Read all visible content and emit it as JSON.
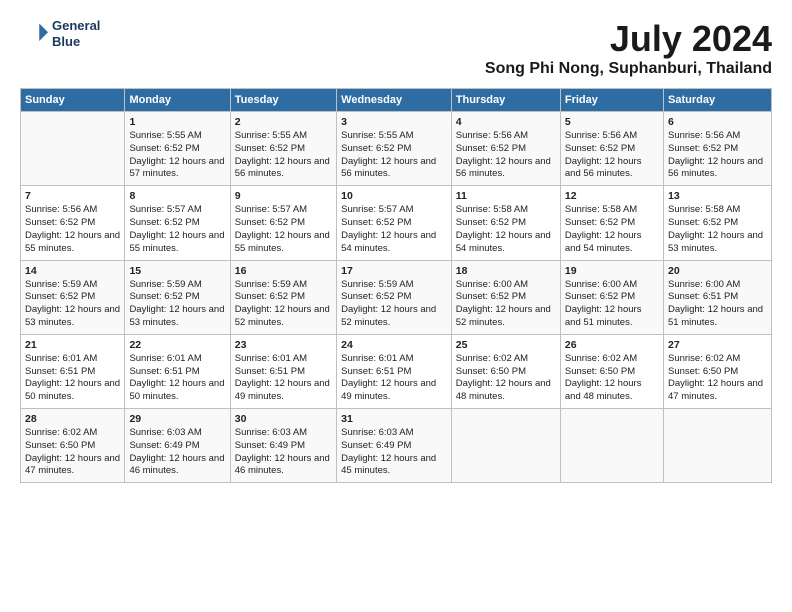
{
  "header": {
    "logo_line1": "General",
    "logo_line2": "Blue",
    "title": "July 2024",
    "subtitle": "Song Phi Nong, Suphanburi, Thailand"
  },
  "columns": [
    "Sunday",
    "Monday",
    "Tuesday",
    "Wednesday",
    "Thursday",
    "Friday",
    "Saturday"
  ],
  "weeks": [
    [
      {
        "day": "",
        "sunrise": "",
        "sunset": "",
        "daylight": ""
      },
      {
        "day": "1",
        "sunrise": "Sunrise: 5:55 AM",
        "sunset": "Sunset: 6:52 PM",
        "daylight": "Daylight: 12 hours and 57 minutes."
      },
      {
        "day": "2",
        "sunrise": "Sunrise: 5:55 AM",
        "sunset": "Sunset: 6:52 PM",
        "daylight": "Daylight: 12 hours and 56 minutes."
      },
      {
        "day": "3",
        "sunrise": "Sunrise: 5:55 AM",
        "sunset": "Sunset: 6:52 PM",
        "daylight": "Daylight: 12 hours and 56 minutes."
      },
      {
        "day": "4",
        "sunrise": "Sunrise: 5:56 AM",
        "sunset": "Sunset: 6:52 PM",
        "daylight": "Daylight: 12 hours and 56 minutes."
      },
      {
        "day": "5",
        "sunrise": "Sunrise: 5:56 AM",
        "sunset": "Sunset: 6:52 PM",
        "daylight": "Daylight: 12 hours and 56 minutes."
      },
      {
        "day": "6",
        "sunrise": "Sunrise: 5:56 AM",
        "sunset": "Sunset: 6:52 PM",
        "daylight": "Daylight: 12 hours and 56 minutes."
      }
    ],
    [
      {
        "day": "7",
        "sunrise": "Sunrise: 5:56 AM",
        "sunset": "Sunset: 6:52 PM",
        "daylight": "Daylight: 12 hours and 55 minutes."
      },
      {
        "day": "8",
        "sunrise": "Sunrise: 5:57 AM",
        "sunset": "Sunset: 6:52 PM",
        "daylight": "Daylight: 12 hours and 55 minutes."
      },
      {
        "day": "9",
        "sunrise": "Sunrise: 5:57 AM",
        "sunset": "Sunset: 6:52 PM",
        "daylight": "Daylight: 12 hours and 55 minutes."
      },
      {
        "day": "10",
        "sunrise": "Sunrise: 5:57 AM",
        "sunset": "Sunset: 6:52 PM",
        "daylight": "Daylight: 12 hours and 54 minutes."
      },
      {
        "day": "11",
        "sunrise": "Sunrise: 5:58 AM",
        "sunset": "Sunset: 6:52 PM",
        "daylight": "Daylight: 12 hours and 54 minutes."
      },
      {
        "day": "12",
        "sunrise": "Sunrise: 5:58 AM",
        "sunset": "Sunset: 6:52 PM",
        "daylight": "Daylight: 12 hours and 54 minutes."
      },
      {
        "day": "13",
        "sunrise": "Sunrise: 5:58 AM",
        "sunset": "Sunset: 6:52 PM",
        "daylight": "Daylight: 12 hours and 53 minutes."
      }
    ],
    [
      {
        "day": "14",
        "sunrise": "Sunrise: 5:59 AM",
        "sunset": "Sunset: 6:52 PM",
        "daylight": "Daylight: 12 hours and 53 minutes."
      },
      {
        "day": "15",
        "sunrise": "Sunrise: 5:59 AM",
        "sunset": "Sunset: 6:52 PM",
        "daylight": "Daylight: 12 hours and 53 minutes."
      },
      {
        "day": "16",
        "sunrise": "Sunrise: 5:59 AM",
        "sunset": "Sunset: 6:52 PM",
        "daylight": "Daylight: 12 hours and 52 minutes."
      },
      {
        "day": "17",
        "sunrise": "Sunrise: 5:59 AM",
        "sunset": "Sunset: 6:52 PM",
        "daylight": "Daylight: 12 hours and 52 minutes."
      },
      {
        "day": "18",
        "sunrise": "Sunrise: 6:00 AM",
        "sunset": "Sunset: 6:52 PM",
        "daylight": "Daylight: 12 hours and 52 minutes."
      },
      {
        "day": "19",
        "sunrise": "Sunrise: 6:00 AM",
        "sunset": "Sunset: 6:52 PM",
        "daylight": "Daylight: 12 hours and 51 minutes."
      },
      {
        "day": "20",
        "sunrise": "Sunrise: 6:00 AM",
        "sunset": "Sunset: 6:51 PM",
        "daylight": "Daylight: 12 hours and 51 minutes."
      }
    ],
    [
      {
        "day": "21",
        "sunrise": "Sunrise: 6:01 AM",
        "sunset": "Sunset: 6:51 PM",
        "daylight": "Daylight: 12 hours and 50 minutes."
      },
      {
        "day": "22",
        "sunrise": "Sunrise: 6:01 AM",
        "sunset": "Sunset: 6:51 PM",
        "daylight": "Daylight: 12 hours and 50 minutes."
      },
      {
        "day": "23",
        "sunrise": "Sunrise: 6:01 AM",
        "sunset": "Sunset: 6:51 PM",
        "daylight": "Daylight: 12 hours and 49 minutes."
      },
      {
        "day": "24",
        "sunrise": "Sunrise: 6:01 AM",
        "sunset": "Sunset: 6:51 PM",
        "daylight": "Daylight: 12 hours and 49 minutes."
      },
      {
        "day": "25",
        "sunrise": "Sunrise: 6:02 AM",
        "sunset": "Sunset: 6:50 PM",
        "daylight": "Daylight: 12 hours and 48 minutes."
      },
      {
        "day": "26",
        "sunrise": "Sunrise: 6:02 AM",
        "sunset": "Sunset: 6:50 PM",
        "daylight": "Daylight: 12 hours and 48 minutes."
      },
      {
        "day": "27",
        "sunrise": "Sunrise: 6:02 AM",
        "sunset": "Sunset: 6:50 PM",
        "daylight": "Daylight: 12 hours and 47 minutes."
      }
    ],
    [
      {
        "day": "28",
        "sunrise": "Sunrise: 6:02 AM",
        "sunset": "Sunset: 6:50 PM",
        "daylight": "Daylight: 12 hours and 47 minutes."
      },
      {
        "day": "29",
        "sunrise": "Sunrise: 6:03 AM",
        "sunset": "Sunset: 6:49 PM",
        "daylight": "Daylight: 12 hours and 46 minutes."
      },
      {
        "day": "30",
        "sunrise": "Sunrise: 6:03 AM",
        "sunset": "Sunset: 6:49 PM",
        "daylight": "Daylight: 12 hours and 46 minutes."
      },
      {
        "day": "31",
        "sunrise": "Sunrise: 6:03 AM",
        "sunset": "Sunset: 6:49 PM",
        "daylight": "Daylight: 12 hours and 45 minutes."
      },
      {
        "day": "",
        "sunrise": "",
        "sunset": "",
        "daylight": ""
      },
      {
        "day": "",
        "sunrise": "",
        "sunset": "",
        "daylight": ""
      },
      {
        "day": "",
        "sunrise": "",
        "sunset": "",
        "daylight": ""
      }
    ]
  ]
}
